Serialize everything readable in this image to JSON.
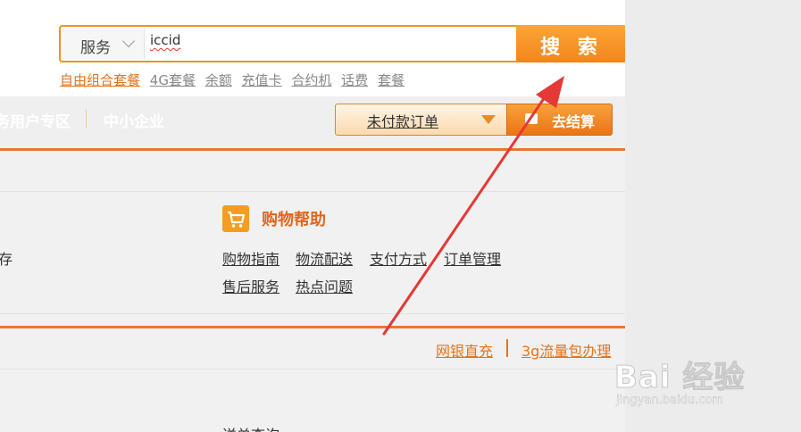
{
  "search": {
    "category": "服务",
    "query": "iccid",
    "button_label": "搜 索"
  },
  "hotwords": [
    "自由组合套餐",
    "4G套餐",
    "余额",
    "充值卡",
    "合约机",
    "话费",
    "套餐"
  ],
  "nav": {
    "left_partial": "务用户专区",
    "sme": "中小企业",
    "order_select": "未付款订单",
    "checkout": "去结算"
  },
  "help": {
    "title": "购物帮助",
    "links": [
      "购物指南",
      "物流配送",
      "支付方式",
      "订单管理",
      "售后服务",
      "热点问题"
    ]
  },
  "cut_left_text": "存",
  "promo": {
    "links": [
      "网银直充",
      "3g流量包办理"
    ]
  },
  "bottom_partial": "送单查询",
  "watermark": {
    "main": "Bai 经验",
    "sub": "jingyan.baidu.com"
  },
  "colors": {
    "brand_orange": "#f0931e",
    "annotation_arrow": "#e53935"
  }
}
